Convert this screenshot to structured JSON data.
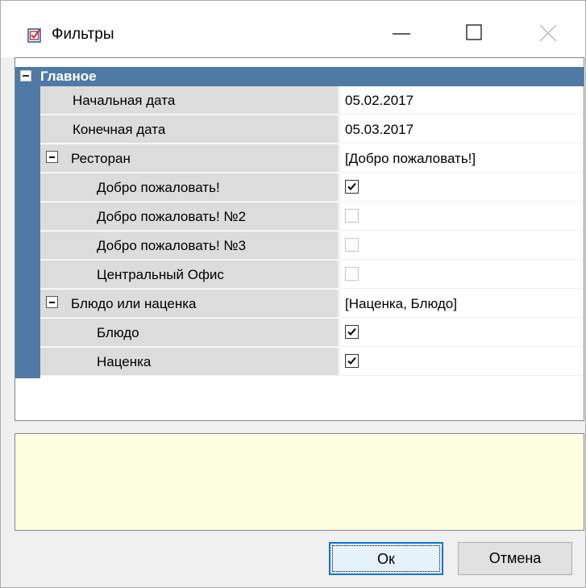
{
  "window": {
    "title": "Фильтры"
  },
  "grid": {
    "category": {
      "label": "Главное"
    },
    "rows": [
      {
        "name": "Начальная дата",
        "value": "05.02.2017"
      },
      {
        "name": "Конечная дата",
        "value": "05.03.2017"
      },
      {
        "name": "Ресторан",
        "value": "[Добро пожаловать!]"
      },
      {
        "name": "Добро пожаловать!",
        "checked": true
      },
      {
        "name": "Добро пожаловать! №2",
        "checked": false
      },
      {
        "name": "Добро пожаловать! №3",
        "checked": false
      },
      {
        "name": "Центральный Офис",
        "checked": false
      },
      {
        "name": "Блюдо или наценка",
        "value": "[Наценка, Блюдо]"
      },
      {
        "name": "Блюдо",
        "checked": true
      },
      {
        "name": "Наценка",
        "checked": true
      }
    ]
  },
  "buttons": {
    "ok": "Ок",
    "cancel": "Отмена"
  },
  "colors": {
    "category_bg": "#4f7aa5",
    "name_cell_bg": "#dcdcdc",
    "description_bg": "#ffffe1",
    "ok_border": "#0078d7"
  }
}
